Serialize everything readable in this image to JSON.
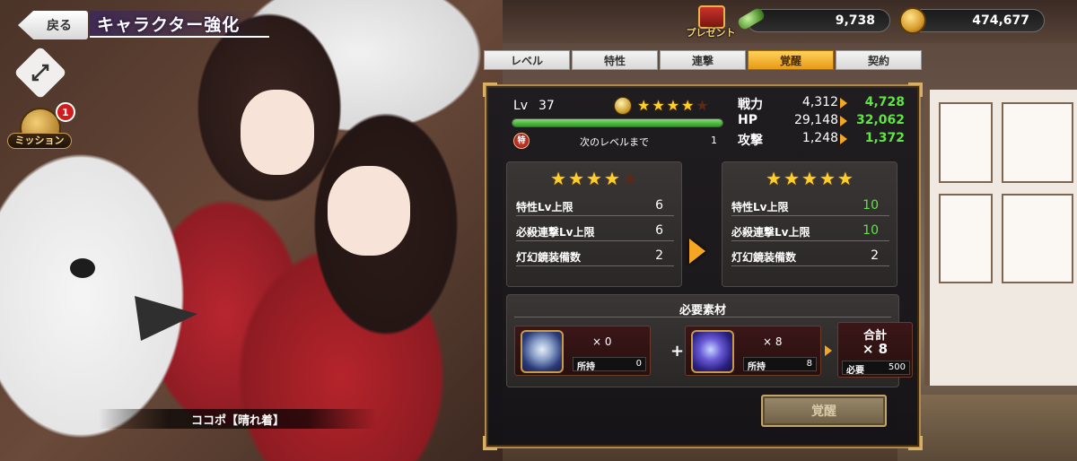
{
  "nav": {
    "back_label": "戻る",
    "page_title": "キャラクター強化",
    "mission_label": "ミッション",
    "mission_badge": "1"
  },
  "character": {
    "name": "ココポ【晴れ着】"
  },
  "header": {
    "present_label": "プレゼント",
    "gems": "9,738",
    "gold": "474,677"
  },
  "tabs": [
    {
      "label": "レベル",
      "active": false
    },
    {
      "label": "特性",
      "active": false
    },
    {
      "label": "連撃",
      "active": false
    },
    {
      "label": "覚醒",
      "active": true
    },
    {
      "label": "契約",
      "active": false
    }
  ],
  "status": {
    "lv_label": "Lv",
    "lv_value": "37",
    "rank_stars": 4,
    "rank_stars_max": 5,
    "xp_progress": 1.0,
    "toku_label": "特",
    "next_label": "次のレベルまで",
    "next_value": "1",
    "stats": [
      {
        "label": "戦力",
        "current": "4,312",
        "next": "4,728"
      },
      {
        "label": "HP",
        "current": "29,148",
        "next": "32,062"
      },
      {
        "label": "攻撃",
        "current": "1,248",
        "next": "1,372"
      }
    ]
  },
  "compare": {
    "before": {
      "stars": 4,
      "rows": [
        {
          "label": "特性Lv上限",
          "value": "6"
        },
        {
          "label": "必殺連撃Lv上限",
          "value": "6"
        },
        {
          "label": "灯幻鏡装備数",
          "value": "2"
        }
      ]
    },
    "after": {
      "stars": 5,
      "rows": [
        {
          "label": "特性Lv上限",
          "value": "10",
          "up": true
        },
        {
          "label": "必殺連撃Lv上限",
          "value": "10",
          "up": true
        },
        {
          "label": "灯幻鏡装備数",
          "value": "2",
          "up": false
        }
      ]
    }
  },
  "materials": {
    "title": "必要素材",
    "items": [
      {
        "icon": "ghost-orb-icon",
        "qty": "× 0",
        "owned_label": "所持",
        "owned": "0"
      },
      {
        "icon": "blue-spirit-icon",
        "qty": "× 8",
        "owned_label": "所持",
        "owned": "8"
      }
    ],
    "plus": "+",
    "total_title": "合計",
    "total_mult": "× 8",
    "need_label": "必要",
    "need_value": "500"
  },
  "awaken_button": "覚醒",
  "colors": {
    "accent_orange": "#f5a623",
    "stat_up_green": "#5fe640",
    "star_gold": "#ffcf2e",
    "panel_border": "#b3894a"
  }
}
